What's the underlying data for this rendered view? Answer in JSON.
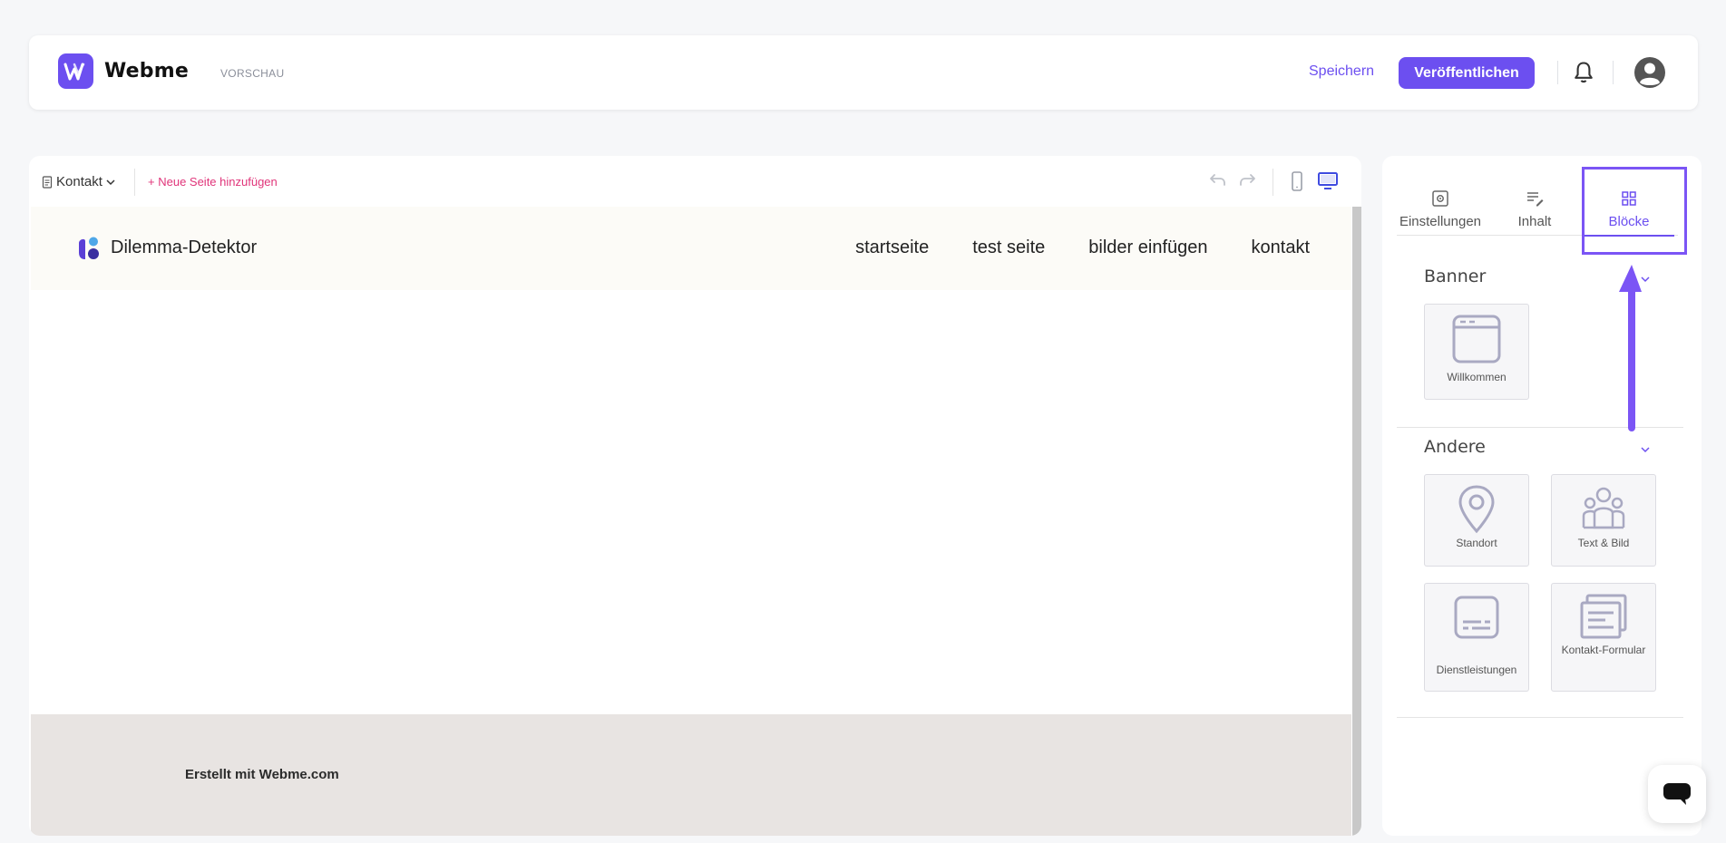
{
  "header": {
    "brand": "Webme",
    "preview_label": "VORSCHAU",
    "save_label": "Speichern",
    "publish_label": "Veröffentlichen"
  },
  "toolbar": {
    "current_page": "Kontakt",
    "add_page_label": "Neue Seite hinzufügen",
    "active_view": "desktop"
  },
  "site": {
    "title": "Dilemma-Detektor",
    "nav": [
      "startseite",
      "test seite",
      "bilder einfügen",
      "kontakt"
    ],
    "footer_text": "Erstellt mit Webme.com"
  },
  "panel": {
    "tabs": [
      {
        "label": "Einstellungen",
        "icon": "settings-icon"
      },
      {
        "label": "Inhalt",
        "icon": "edit-text-icon"
      },
      {
        "label": "Blöcke",
        "icon": "grid-icon",
        "active": true
      }
    ],
    "sections": [
      {
        "title": "Banner",
        "blocks": [
          {
            "label": "Willkommen",
            "icon": "browser-window-icon"
          }
        ]
      },
      {
        "title": "Andere",
        "blocks": [
          {
            "label": "Standort",
            "icon": "location-pin-icon"
          },
          {
            "label": "Text & Bild",
            "icon": "people-icon"
          },
          {
            "label": "Dienstleistungen",
            "icon": "subtitles-icon"
          },
          {
            "label": "Kontakt-Formular",
            "icon": "form-icon"
          }
        ]
      }
    ]
  },
  "colors": {
    "accent": "#6c4ff0",
    "add_page": "#e0357a",
    "footer_bg": "#e8e4e2",
    "site_header_bg": "#fcfbf7"
  }
}
